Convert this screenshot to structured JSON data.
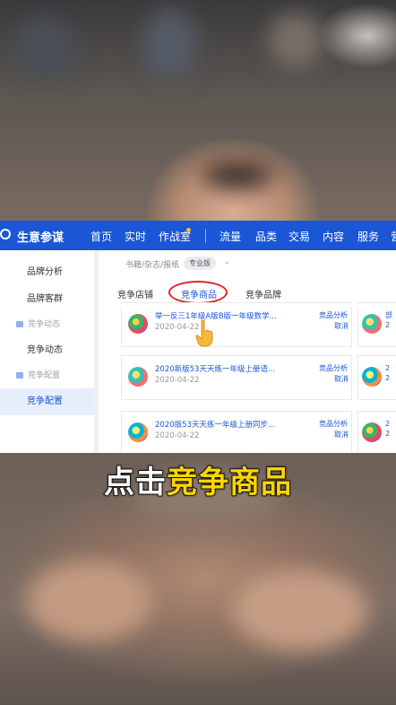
{
  "topnav": {
    "brand": "生意参谋",
    "items": [
      "首页",
      "实时",
      "作战室",
      "流量",
      "品类",
      "交易",
      "内容",
      "服务",
      "营"
    ]
  },
  "sidebar": {
    "items": [
      {
        "label": "品牌分析",
        "type": "item"
      },
      {
        "label": "品牌客群",
        "type": "item"
      },
      {
        "label": "竞争动态",
        "type": "group"
      },
      {
        "label": "竞争动态",
        "type": "item"
      },
      {
        "label": "竞争配置",
        "type": "group"
      },
      {
        "label": "竞争配置",
        "type": "item",
        "active": true
      }
    ]
  },
  "main": {
    "breadcrumb": "书籍/杂志/报纸",
    "badge": "专业版",
    "tabs": [
      {
        "label": "竞争店铺"
      },
      {
        "label": "竞争商品",
        "active": true
      },
      {
        "label": "竞争品牌"
      }
    ],
    "cards": [
      {
        "title": "举一反三1年级A版B版一年级数学...",
        "date": "2020-04-22",
        "action1": "竞品分析",
        "action2": "取消"
      },
      {
        "title": "2020新版53天天练一年级上册语...",
        "date": "2020-04-22",
        "action1": "竞品分析",
        "action2": "取消"
      },
      {
        "title": "2020版53天天练一年级上册同步...",
        "date": "2020-04-22",
        "action1": "竞品分析",
        "action2": "取消"
      }
    ],
    "side_cards": [
      {
        "line1": "部",
        "line2": "2"
      },
      {
        "line1": "2",
        "line2": "2"
      },
      {
        "line1": "2",
        "line2": "2"
      }
    ]
  },
  "caption": {
    "part1": "点击",
    "part2": "竞争商品"
  },
  "colors": {
    "nav_blue": "#1a56d6",
    "highlight_red": "#e02424",
    "caption_yellow": "#ffd600"
  }
}
